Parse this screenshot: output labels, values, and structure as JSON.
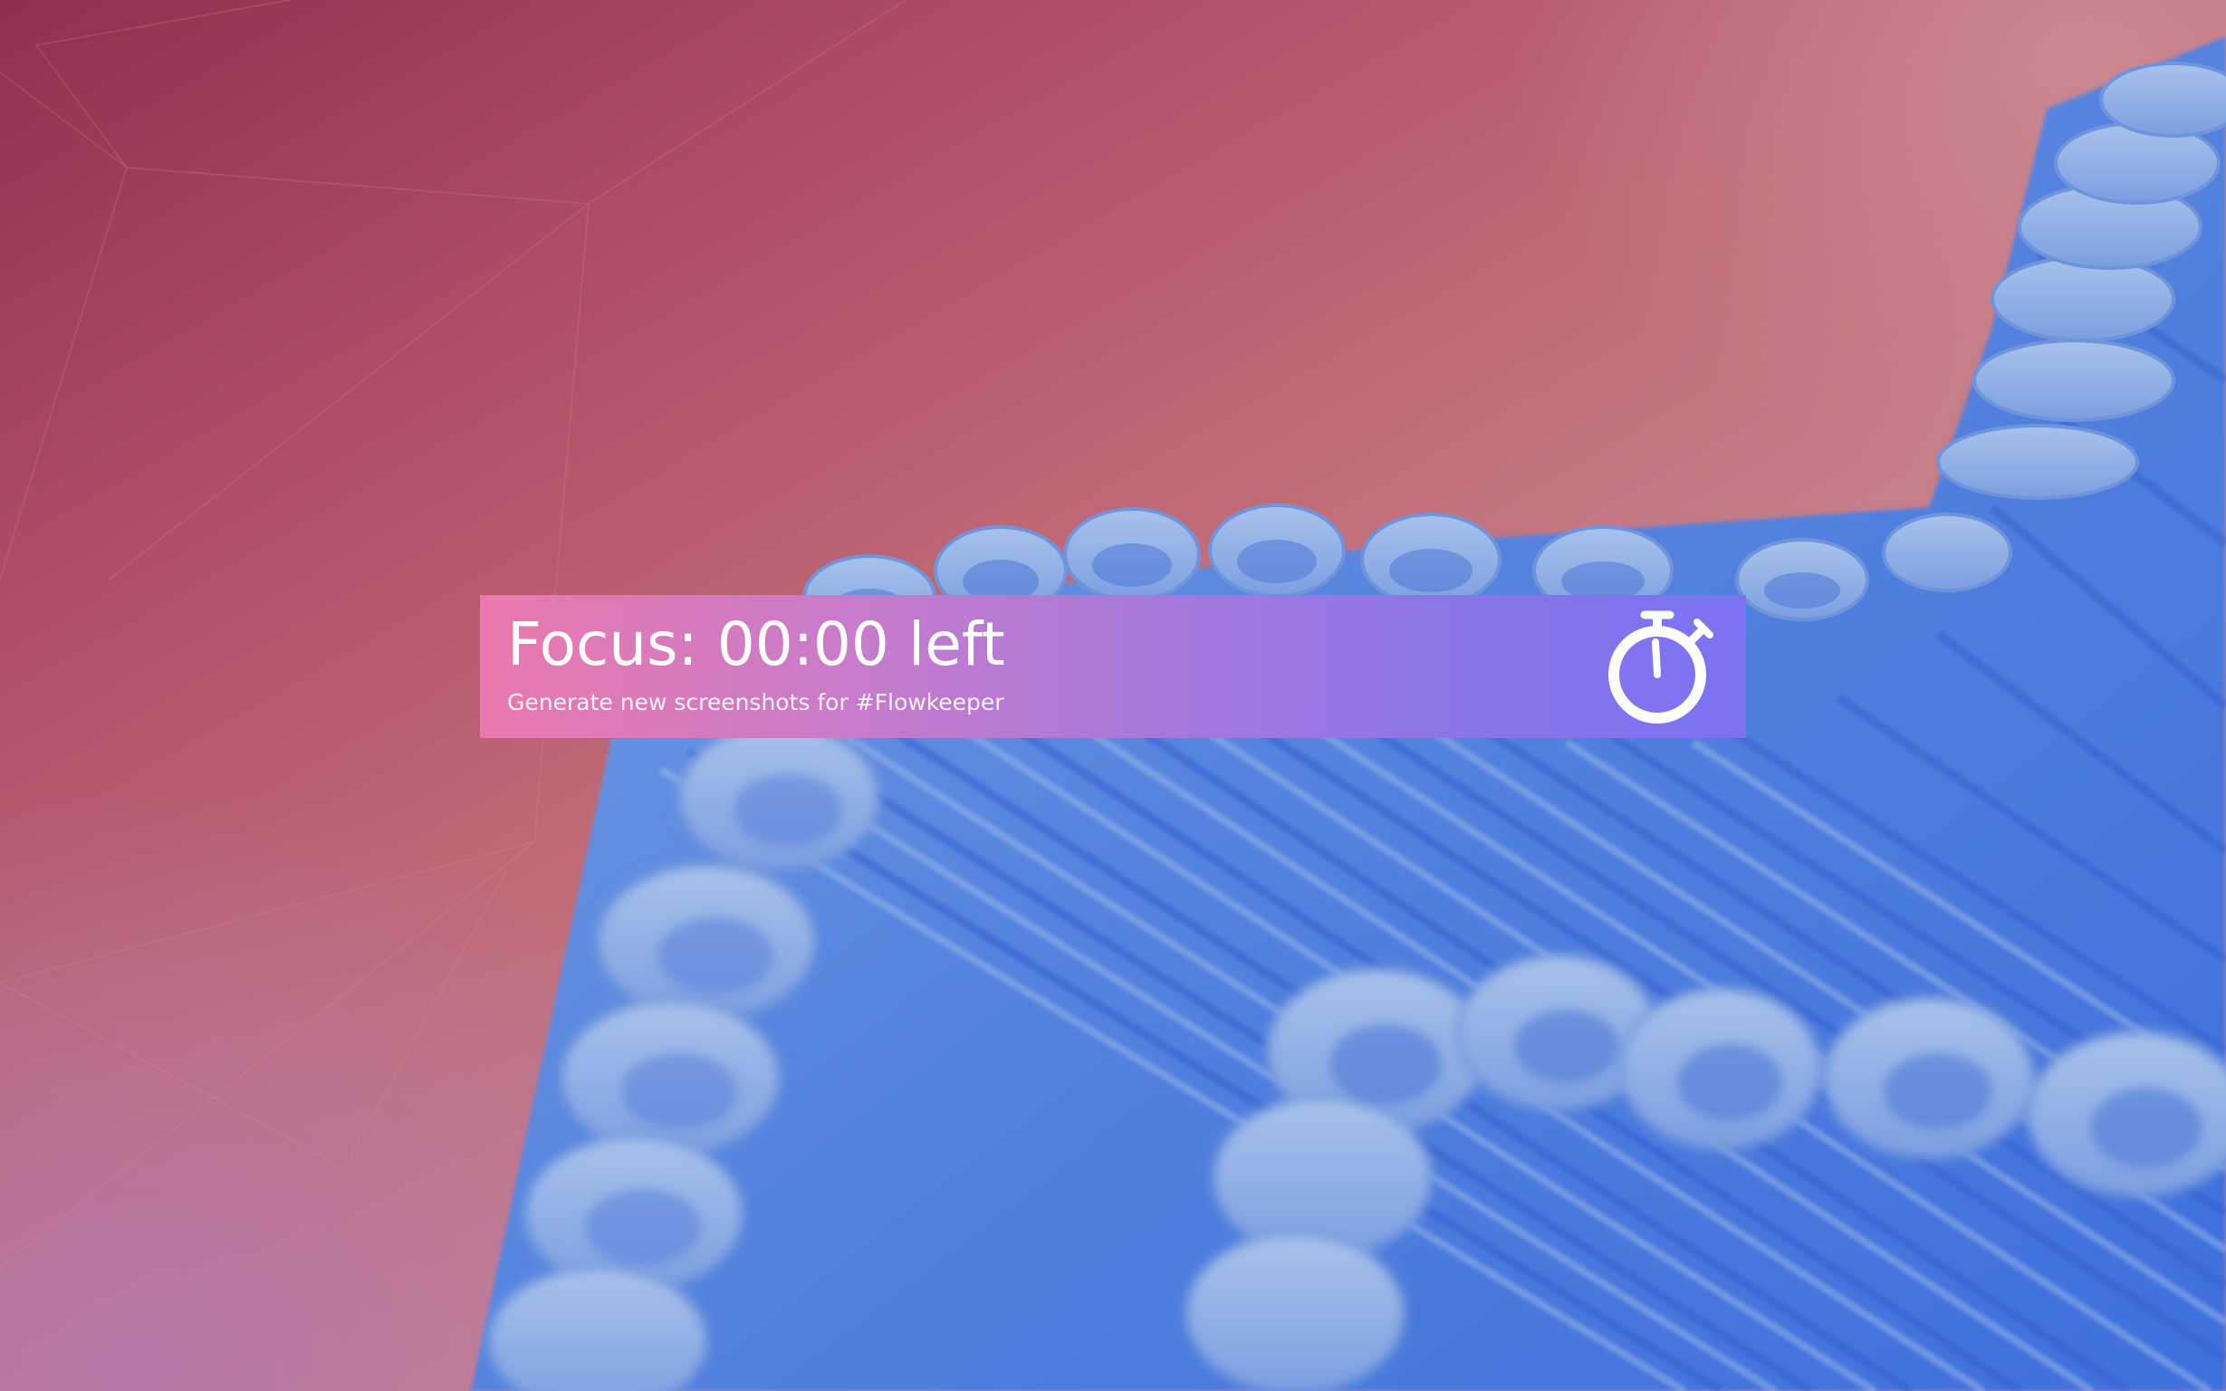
{
  "timer": {
    "title": "Focus: 00:00 left",
    "subtitle": "Generate new screenshots for #Flowkeeper",
    "icon": "stopwatch-icon"
  },
  "colors": {
    "widget_gradient_start": "#ea79ad",
    "widget_gradient_end": "#7b72f3",
    "text": "#ffffff",
    "wallpaper_top_left": "#8e3050",
    "wallpaper_ribbons": "#5f8fe0"
  }
}
